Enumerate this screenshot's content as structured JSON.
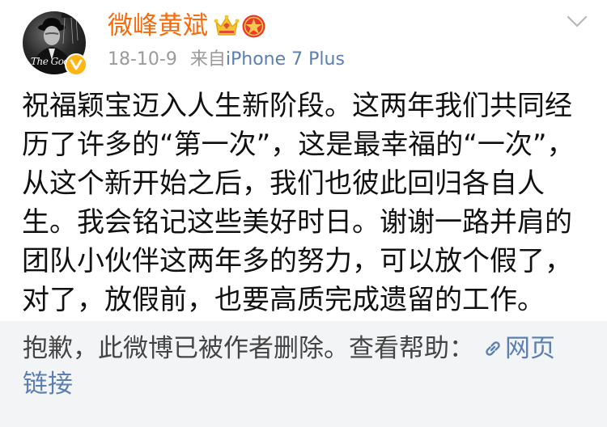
{
  "post": {
    "author": {
      "name": "微峰黄斌",
      "avatar_caption": "The Godfa",
      "verified_icon": "verified-v-icon",
      "badges": [
        "crown-icon",
        "star-badge-icon"
      ]
    },
    "date": "18-10-9",
    "source_prefix": "来自",
    "source": "iPhone 7 Plus",
    "menu_icon": "chevron-down-icon",
    "text_lines": [
      "祝福颖宝迈入人生新阶段。这两年我们共同经",
      "历了许多的“第一次”，这是最幸福的“一次”，",
      "从这个新开始之后，我们也彼此回归各自人",
      "生。我会铭记这些美好时日。谢谢一路并肩的",
      "团队小伙伴这两年多的努力，可以放个假了，",
      "对了，放假前，也要高质完成遗留的工作。"
    ]
  },
  "retweet": {
    "deleted_text": "抱歉，此微博已被作者删除。查看帮助：",
    "link_icon": "link-icon",
    "link_text_part1": "网页",
    "link_text_part2": "链接"
  },
  "colors": {
    "name": "#f86a0a",
    "link": "#5b7fb0",
    "meta": "#9a9a9a",
    "retweet_bg": "#f3f4f6",
    "verified": "#ffb514"
  }
}
